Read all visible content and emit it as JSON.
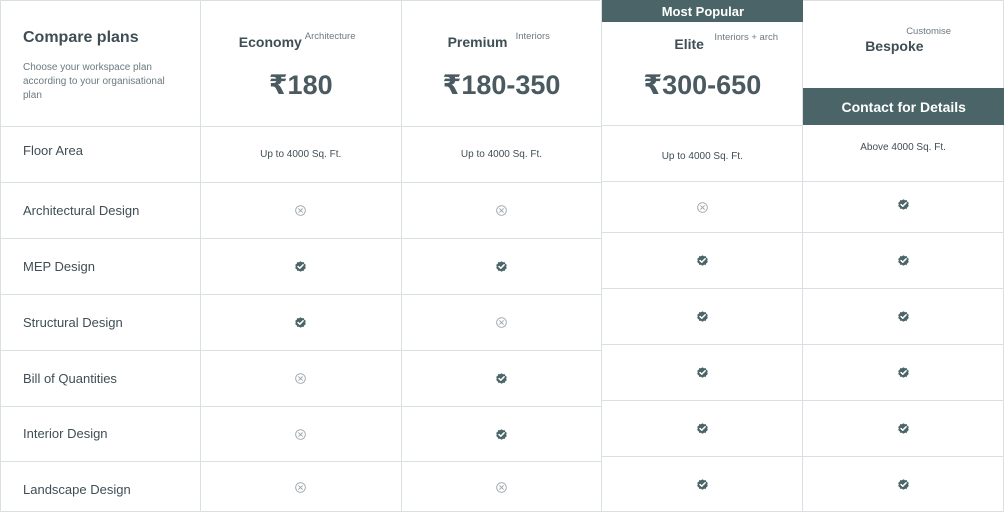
{
  "intro": {
    "title": "Compare plans",
    "subtitle": "Choose your workspace plan according to your organisational plan"
  },
  "features": [
    "Floor Area",
    "Architectural Design",
    "MEP Design",
    "Structural Design",
    "Bill of Quantities",
    "Interior Design",
    "Landscape Design"
  ],
  "plans": [
    {
      "name": "Economy",
      "tag": "Architecture",
      "price": "₹180",
      "floor_area": "Up to 4000 Sq. Ft.",
      "features": [
        "not-included",
        "included",
        "included",
        "not-included",
        "not-included",
        "not-included"
      ]
    },
    {
      "name": "Premium",
      "tag": "Interiors",
      "price": "₹180-350",
      "floor_area": "Up to 4000 Sq. Ft.",
      "features": [
        "not-included",
        "included",
        "not-included",
        "included",
        "included",
        "not-included"
      ]
    },
    {
      "name": "Elite",
      "tag": "Interiors + arch",
      "price": "₹300-650",
      "badge": "Most Popular",
      "floor_area": "Up to 4000 Sq. Ft.",
      "features": [
        "not-included",
        "included",
        "included",
        "included",
        "included",
        "included"
      ]
    },
    {
      "name": "Bespoke",
      "tag": "Customise",
      "cta": "Contact for Details",
      "floor_area": "Above 4000 Sq. Ft.",
      "features": [
        "included",
        "included",
        "included",
        "included",
        "included",
        "included"
      ]
    }
  ],
  "icons": {
    "included": "check-badge-icon",
    "not_included": "x-circle-icon"
  },
  "colors": {
    "accent": "#4a6468",
    "text": "#3f4e55",
    "border": "#d9dfe2",
    "muted": "#6b7a80",
    "not_included": "#9aa6ab"
  }
}
